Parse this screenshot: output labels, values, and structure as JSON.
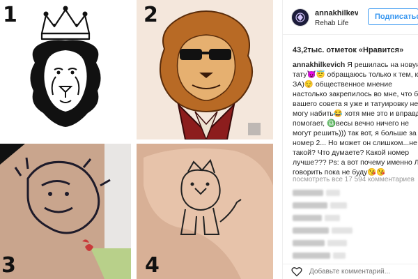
{
  "photo": {
    "labels": [
      "1",
      "2",
      "3",
      "4"
    ]
  },
  "post": {
    "username": "annakhilkevich",
    "location": "Rehab Life",
    "follow_label": "Подписаться",
    "likes": "43,2тыс. отметок «Нравится»",
    "caption_user": "annakhilkevich",
    "caption_lines": [
      " Я решилась на новую",
      "тату😈😇 обращаюсь только к тем, кто",
      "ЗА)😌 общественное мнение",
      "настолько закрепилось во мне, что без",
      "вашего совета я уже и татуировку не",
      "могу набить😂 хотя мне это и вправду",
      "помогает, ♎весы вечно ничего не",
      "могут решить))) так вот, я больше за",
      "номер 2... Но может он слишком...не",
      "такой? Что думаете? Какой номер",
      "лучше??? Ps: а вот почему именно Лев",
      "говорить пока не буду😘😘"
    ],
    "view_all": "посмотреть все 17 594 комментариев",
    "add_comment_placeholder": "Добавьте комментарий..."
  },
  "colors": {
    "accent": "#3897f0",
    "text": "#262626",
    "muted": "#999999"
  }
}
